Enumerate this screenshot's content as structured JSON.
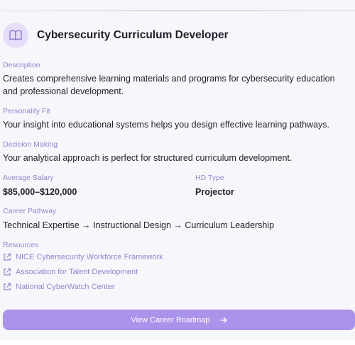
{
  "header": {
    "title": "Cybersecurity Curriculum Developer",
    "icon": "book-icon"
  },
  "sections": {
    "description_label": "Description",
    "description": "Creates comprehensive learning materials and programs for cybersecurity education and professional development.",
    "personality_label": "Personality Fit",
    "personality": "Your insight into educational systems helps you design effective learning pathways.",
    "decision_label": "Decision Making",
    "decision": "Your analytical approach is perfect for structured curriculum development.",
    "salary_label": "Average Salary",
    "salary": "$85,000–$120,000",
    "hd_label": "HD Type",
    "hd": "Projector",
    "pathway_label": "Career Pathway",
    "pathway": "Technical Expertise → Instructional Design → Curriculum Leadership",
    "resources_label": "Resources"
  },
  "resources": [
    "NICE Cybersecurity Workforce Framework",
    "Association for Talent Development",
    "National CyberWatch Center"
  ],
  "cta": {
    "label": "View Career Roadmap"
  },
  "colors": {
    "accent": "#9a82cf",
    "button": "#aa93ea",
    "icon_bg": "#e6def8"
  }
}
